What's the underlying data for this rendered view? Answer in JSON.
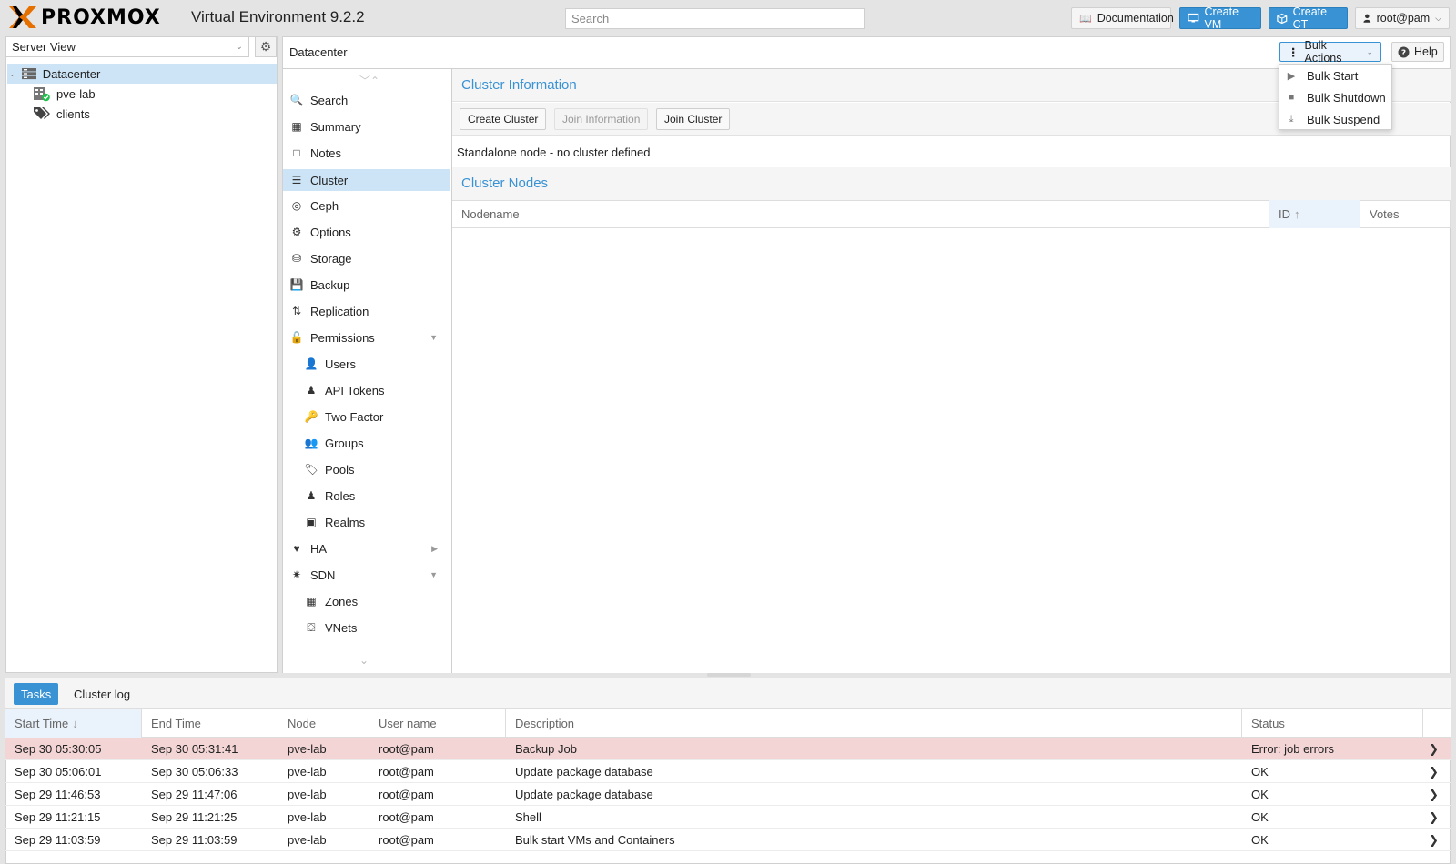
{
  "app": {
    "logo_text": "PROXMOX",
    "title": "Virtual Environment 9.2.2",
    "search_placeholder": "Search",
    "docs_label": "Documentation",
    "create_vm_label": "Create VM",
    "create_ct_label": "Create CT",
    "user_label": "root@pam",
    "accent_color": "#3892d4",
    "logo_color": "#e57000"
  },
  "tree": {
    "view_label": "Server View",
    "items": [
      {
        "label": "Datacenter",
        "icon": "datacenter-icon",
        "selected": true
      },
      {
        "label": "pve-lab",
        "icon": "node-online-icon"
      },
      {
        "label": "clients",
        "icon": "tags-icon"
      }
    ]
  },
  "content": {
    "title": "Datacenter",
    "bulk_actions_label": "Bulk Actions",
    "help_label": "Help"
  },
  "nav": [
    {
      "label": "Search",
      "icon": "search-icon"
    },
    {
      "label": "Summary",
      "icon": "book-icon"
    },
    {
      "label": "Notes",
      "icon": "notes-icon"
    },
    {
      "label": "Cluster",
      "icon": "server-icon",
      "active": true
    },
    {
      "label": "Ceph",
      "icon": "ceph-icon"
    },
    {
      "label": "Options",
      "icon": "gear-icon"
    },
    {
      "label": "Storage",
      "icon": "database-icon"
    },
    {
      "label": "Backup",
      "icon": "floppy-icon"
    },
    {
      "label": "Replication",
      "icon": "retweet-icon"
    },
    {
      "label": "Permissions",
      "icon": "unlock-icon",
      "expanded": true
    },
    {
      "label": "Users",
      "icon": "user-icon",
      "sub": true
    },
    {
      "label": "API Tokens",
      "icon": "user-outline-icon",
      "sub": true
    },
    {
      "label": "Two Factor",
      "icon": "key-icon",
      "sub": true
    },
    {
      "label": "Groups",
      "icon": "users-icon",
      "sub": true
    },
    {
      "label": "Pools",
      "icon": "tags-icon",
      "sub": true
    },
    {
      "label": "Roles",
      "icon": "male-icon",
      "sub": true
    },
    {
      "label": "Realms",
      "icon": "address-book-icon",
      "sub": true
    },
    {
      "label": "HA",
      "icon": "heartbeat-icon",
      "collapsed": true
    },
    {
      "label": "SDN",
      "icon": "sdn-icon",
      "expanded": true
    },
    {
      "label": "Zones",
      "icon": "th-icon",
      "sub": true
    },
    {
      "label": "VNets",
      "icon": "network-icon",
      "sub": true
    }
  ],
  "cluster": {
    "info_title": "Cluster Information",
    "create_cluster_label": "Create Cluster",
    "join_info_label": "Join Information",
    "join_cluster_label": "Join Cluster",
    "standalone_text": "Standalone node - no cluster defined",
    "nodes_title": "Cluster Nodes",
    "columns": [
      "Nodename",
      "ID",
      "Votes"
    ]
  },
  "bulk_menu": [
    {
      "label": "Bulk Start",
      "icon": "play-icon"
    },
    {
      "label": "Bulk Shutdown",
      "icon": "stop-icon"
    },
    {
      "label": "Bulk Suspend",
      "icon": "download-icon"
    }
  ],
  "bottom": {
    "tabs": [
      "Tasks",
      "Cluster log"
    ],
    "columns": [
      "Start Time",
      "End Time",
      "Node",
      "User name",
      "Description",
      "Status"
    ],
    "rows": [
      {
        "start": "Sep 30 05:30:05",
        "end": "Sep 30 05:31:41",
        "node": "pve-lab",
        "user": "root@pam",
        "desc": "Backup Job",
        "status": "Error: job errors",
        "error": true
      },
      {
        "start": "Sep 30 05:06:01",
        "end": "Sep 30 05:06:33",
        "node": "pve-lab",
        "user": "root@pam",
        "desc": "Update package database",
        "status": "OK"
      },
      {
        "start": "Sep 29 11:46:53",
        "end": "Sep 29 11:47:06",
        "node": "pve-lab",
        "user": "root@pam",
        "desc": "Update package database",
        "status": "OK"
      },
      {
        "start": "Sep 29 11:21:15",
        "end": "Sep 29 11:21:25",
        "node": "pve-lab",
        "user": "root@pam",
        "desc": "Shell",
        "status": "OK"
      },
      {
        "start": "Sep 29 11:03:59",
        "end": "Sep 29 11:03:59",
        "node": "pve-lab",
        "user": "root@pam",
        "desc": "Bulk start VMs and Containers",
        "status": "OK"
      }
    ]
  }
}
